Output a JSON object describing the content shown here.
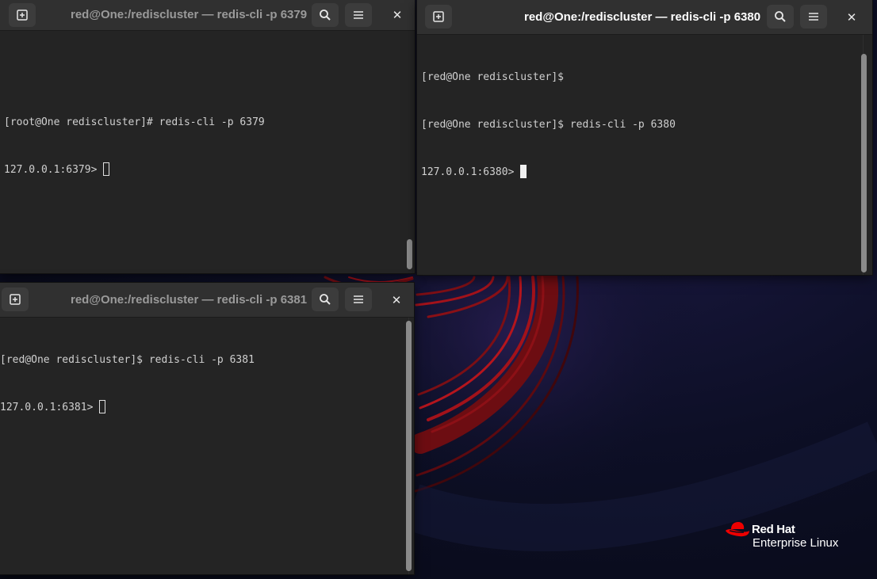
{
  "desktop": {
    "logo": {
      "brand": "Red Hat",
      "product": "Enterprise Linux"
    }
  },
  "terminals": {
    "t6379": {
      "title": "red@One:/rediscluster — redis-cli -p 6379",
      "lines": [
        "",
        "[root@One rediscluster]# redis-cli -p 6379"
      ],
      "prompt": "127.0.0.1:6379> "
    },
    "t6380": {
      "title": "red@One:/rediscluster — redis-cli -p 6380",
      "lines": [
        "[red@One rediscluster]$",
        "[red@One rediscluster]$ redis-cli -p 6380"
      ],
      "prompt": "127.0.0.1:6380> "
    },
    "t6381": {
      "title": "red@One:/rediscluster — redis-cli -p 6381",
      "lines": [
        "[red@One rediscluster]$ redis-cli -p 6381"
      ],
      "prompt": "127.0.0.1:6381> "
    }
  },
  "icons": {
    "new_tab": "new-tab-icon",
    "search": "search-icon",
    "menu": "hamburger-menu-icon",
    "close": "close-icon"
  },
  "colors": {
    "headerbar": "#303030",
    "terminal_bg": "#242424",
    "text": "#d0d0d0",
    "wallpaper_accent": "#b5121b"
  }
}
